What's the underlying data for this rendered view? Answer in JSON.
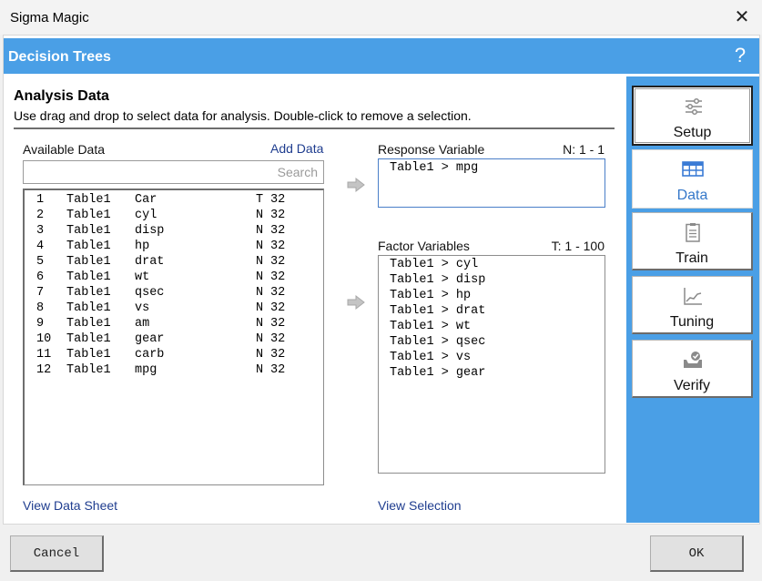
{
  "window": {
    "title": "Sigma Magic",
    "close_glyph": "✕"
  },
  "header": {
    "title": "Decision Trees",
    "help_glyph": "?"
  },
  "section": {
    "title": "Analysis Data",
    "description": "Use drag and drop to select data for analysis. Double-click to remove a selection."
  },
  "available": {
    "label": "Available Data",
    "add_link": "Add Data",
    "search_placeholder": "Search",
    "rows": [
      {
        "num": "1",
        "table": "Table1",
        "name": "Car",
        "type": "T",
        "count": "32"
      },
      {
        "num": "2",
        "table": "Table1",
        "name": "cyl",
        "type": "N",
        "count": "32"
      },
      {
        "num": "3",
        "table": "Table1",
        "name": "disp",
        "type": "N",
        "count": "32"
      },
      {
        "num": "4",
        "table": "Table1",
        "name": "hp",
        "type": "N",
        "count": "32"
      },
      {
        "num": "5",
        "table": "Table1",
        "name": "drat",
        "type": "N",
        "count": "32"
      },
      {
        "num": "6",
        "table": "Table1",
        "name": "wt",
        "type": "N",
        "count": "32"
      },
      {
        "num": "7",
        "table": "Table1",
        "name": "qsec",
        "type": "N",
        "count": "32"
      },
      {
        "num": "8",
        "table": "Table1",
        "name": "vs",
        "type": "N",
        "count": "32"
      },
      {
        "num": "9",
        "table": "Table1",
        "name": "am",
        "type": "N",
        "count": "32"
      },
      {
        "num": "10",
        "table": "Table1",
        "name": "gear",
        "type": "N",
        "count": "32"
      },
      {
        "num": "11",
        "table": "Table1",
        "name": "carb",
        "type": "N",
        "count": "32"
      },
      {
        "num": "12",
        "table": "Table1",
        "name": "mpg",
        "type": "N",
        "count": "32"
      }
    ],
    "view_link": "View Data Sheet"
  },
  "response": {
    "label": "Response Variable",
    "range": "N: 1 - 1",
    "items": [
      "Table1 > mpg"
    ]
  },
  "factors": {
    "label": "Factor Variables",
    "range": "T: 1 - 100",
    "items": [
      "Table1 > cyl",
      "Table1 > disp",
      "Table1 > hp",
      "Table1 > drat",
      "Table1 > wt",
      "Table1 > qsec",
      "Table1 > vs",
      "Table1 > gear"
    ]
  },
  "view_selection_link": "View Selection",
  "nav": {
    "setup": "Setup",
    "data": "Data",
    "train": "Train",
    "tuning": "Tuning",
    "verify": "Verify"
  },
  "buttons": {
    "cancel": "Cancel",
    "ok": "OK"
  },
  "colors": {
    "accent": "#4a9fe6",
    "link": "#1f3d8f",
    "selected_nav": "#3578c9"
  }
}
